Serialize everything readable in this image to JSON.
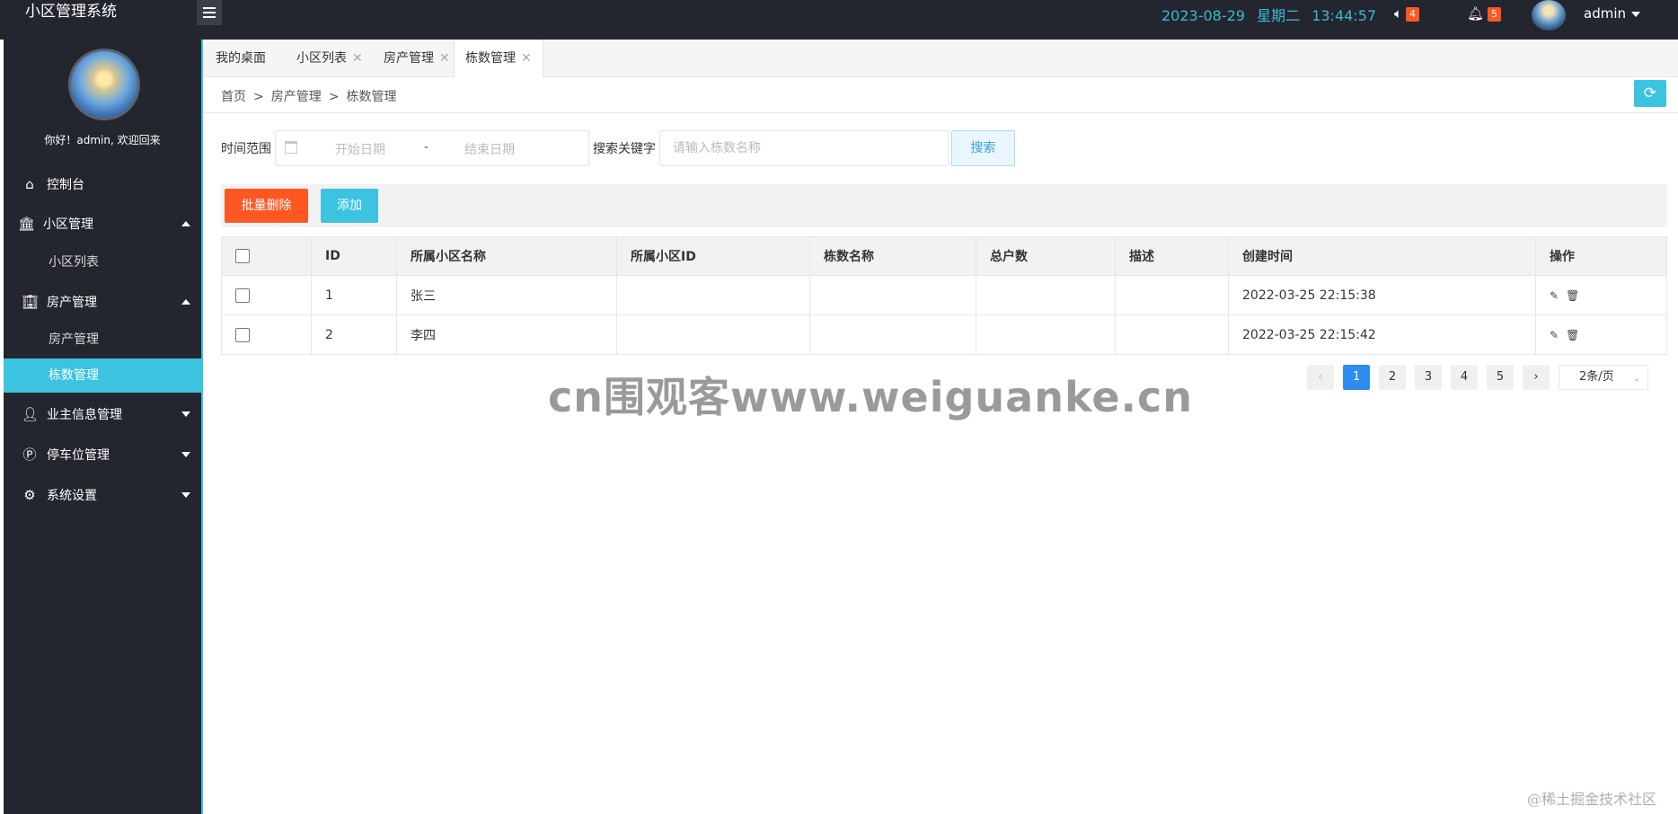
{
  "app": {
    "title": "小区管理系统"
  },
  "header": {
    "date": "2023-08-29",
    "weekday": "星期二",
    "time": "13:44:57",
    "sound_badge": "4",
    "bell_badge": "5",
    "username": "admin"
  },
  "sidebar": {
    "welcome": "你好！admin, 欢迎回来",
    "items": [
      {
        "label": "控制台",
        "icon": "home-icon"
      },
      {
        "label": "小区管理",
        "icon": "bank-icon"
      },
      {
        "label": "小区列表"
      },
      {
        "label": "房产管理",
        "icon": "building-icon"
      },
      {
        "label": "房产管理"
      },
      {
        "label": "栋数管理"
      },
      {
        "label": "业主信息管理",
        "icon": "user-icon"
      },
      {
        "label": "停车位管理",
        "icon": "parking-icon"
      },
      {
        "label": "系统设置",
        "icon": "gear-icon"
      }
    ]
  },
  "tabs": [
    {
      "label": "我的桌面"
    },
    {
      "label": "小区列表"
    },
    {
      "label": "房产管理"
    },
    {
      "label": "栋数管理"
    }
  ],
  "breadcrumb": [
    "首页",
    "房产管理",
    "栋数管理"
  ],
  "search": {
    "time_label": "时间范围",
    "start_placeholder": "开始日期",
    "range_sep": "-",
    "end_placeholder": "结束日期",
    "keyword_label": "搜索关键字",
    "keyword_placeholder": "请输入栋数名称",
    "button": "搜索"
  },
  "toolbar": {
    "delete_label": "批量删除",
    "add_label": "添加"
  },
  "table": {
    "columns": [
      "ID",
      "所属小区名称",
      "所属小区ID",
      "栋数名称",
      "总户数",
      "描述",
      "创建时间",
      "操作"
    ],
    "rows": [
      {
        "id": "1",
        "community_name": "张三",
        "community_id": "",
        "building_name": "",
        "households": "",
        "description": "",
        "created": "2022-03-25 22:15:38"
      },
      {
        "id": "2",
        "community_name": "李四",
        "community_id": "",
        "building_name": "",
        "households": "",
        "description": "",
        "created": "2022-03-25 22:15:42"
      }
    ]
  },
  "pagination": {
    "pages": [
      "1",
      "2",
      "3",
      "4",
      "5"
    ],
    "current": "1",
    "page_size": "2条/页",
    "prev": "‹",
    "next": "›"
  },
  "watermark": "cn围观客www.weiguanke.cn",
  "corner_mark": "@稀土掘金技术社区",
  "colors": {
    "accent": "#3bc3df",
    "danger": "#ff5722",
    "dark": "#23262e",
    "primary": "#2d8cf0"
  }
}
